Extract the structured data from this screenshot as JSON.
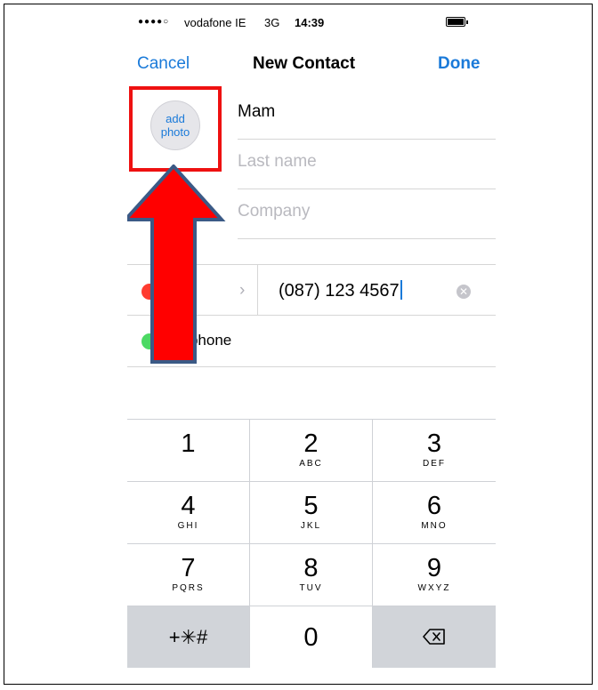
{
  "status_bar": {
    "signal": "●●●●○",
    "carrier": "vodafone IE",
    "network": "3G",
    "time": "14:39"
  },
  "nav": {
    "cancel_label": "Cancel",
    "title": "New Contact",
    "done_label": "Done"
  },
  "photo": {
    "label_line1": "add",
    "label_line2": "photo"
  },
  "fields": {
    "first_name_value": "Mam",
    "last_name_placeholder": "Last name",
    "company_placeholder": "Company"
  },
  "phone_entry": {
    "label_visible": "me",
    "chevron": "›",
    "value": "(087) 123 4567",
    "clear_glyph": "✕"
  },
  "add_phone": {
    "label_visible": "ld phone"
  },
  "keypad": {
    "keys": [
      {
        "num": "1",
        "letters": ""
      },
      {
        "num": "2",
        "letters": "ABC"
      },
      {
        "num": "3",
        "letters": "DEF"
      },
      {
        "num": "4",
        "letters": "GHI"
      },
      {
        "num": "5",
        "letters": "JKL"
      },
      {
        "num": "6",
        "letters": "MNO"
      },
      {
        "num": "7",
        "letters": "PQRS"
      },
      {
        "num": "8",
        "letters": "TUV"
      },
      {
        "num": "9",
        "letters": "WXYZ"
      },
      {
        "num": "+✳#",
        "letters": ""
      },
      {
        "num": "0",
        "letters": ""
      },
      {
        "num": "",
        "letters": ""
      }
    ]
  },
  "colors": {
    "accent_blue": "#1a7ad9",
    "annotation_red": "#ee1111",
    "remove_red": "#ff3b30",
    "add_green": "#4cd964",
    "keypad_dark": "#d1d4d9"
  }
}
